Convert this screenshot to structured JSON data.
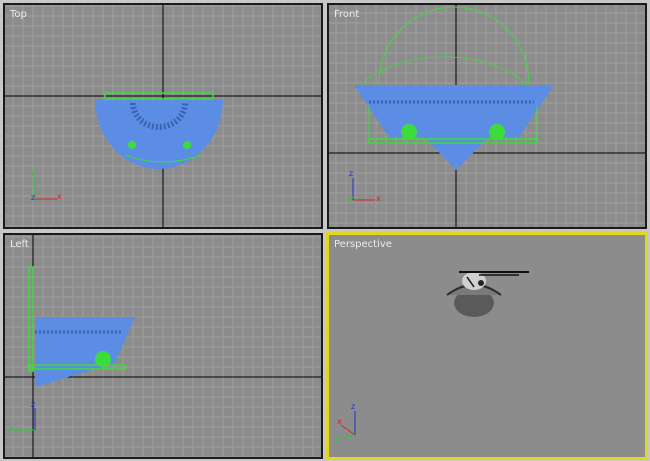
{
  "viewports": {
    "top": {
      "label": "Top",
      "active": false
    },
    "front": {
      "label": "Front",
      "active": false
    },
    "left": {
      "label": "Left",
      "active": false
    },
    "perspective": {
      "label": "Perspective",
      "active": true
    }
  },
  "colors": {
    "grid_background": "#8c8c8c",
    "grid_line": "#9f9f9f",
    "world_axis_line": "#000000",
    "mesh_blue": "#5b8de4",
    "helper_green": "#3ddc3d",
    "active_border": "#e0d81e",
    "inactive_border": "#1a1a1a",
    "perspective_background": "#8c8c8c",
    "axis_x": "#e02020",
    "axis_y": "#20d020",
    "axis_z": "#2030d0"
  },
  "axis_tripod": {
    "x": "x",
    "y": "y",
    "z": "z"
  }
}
